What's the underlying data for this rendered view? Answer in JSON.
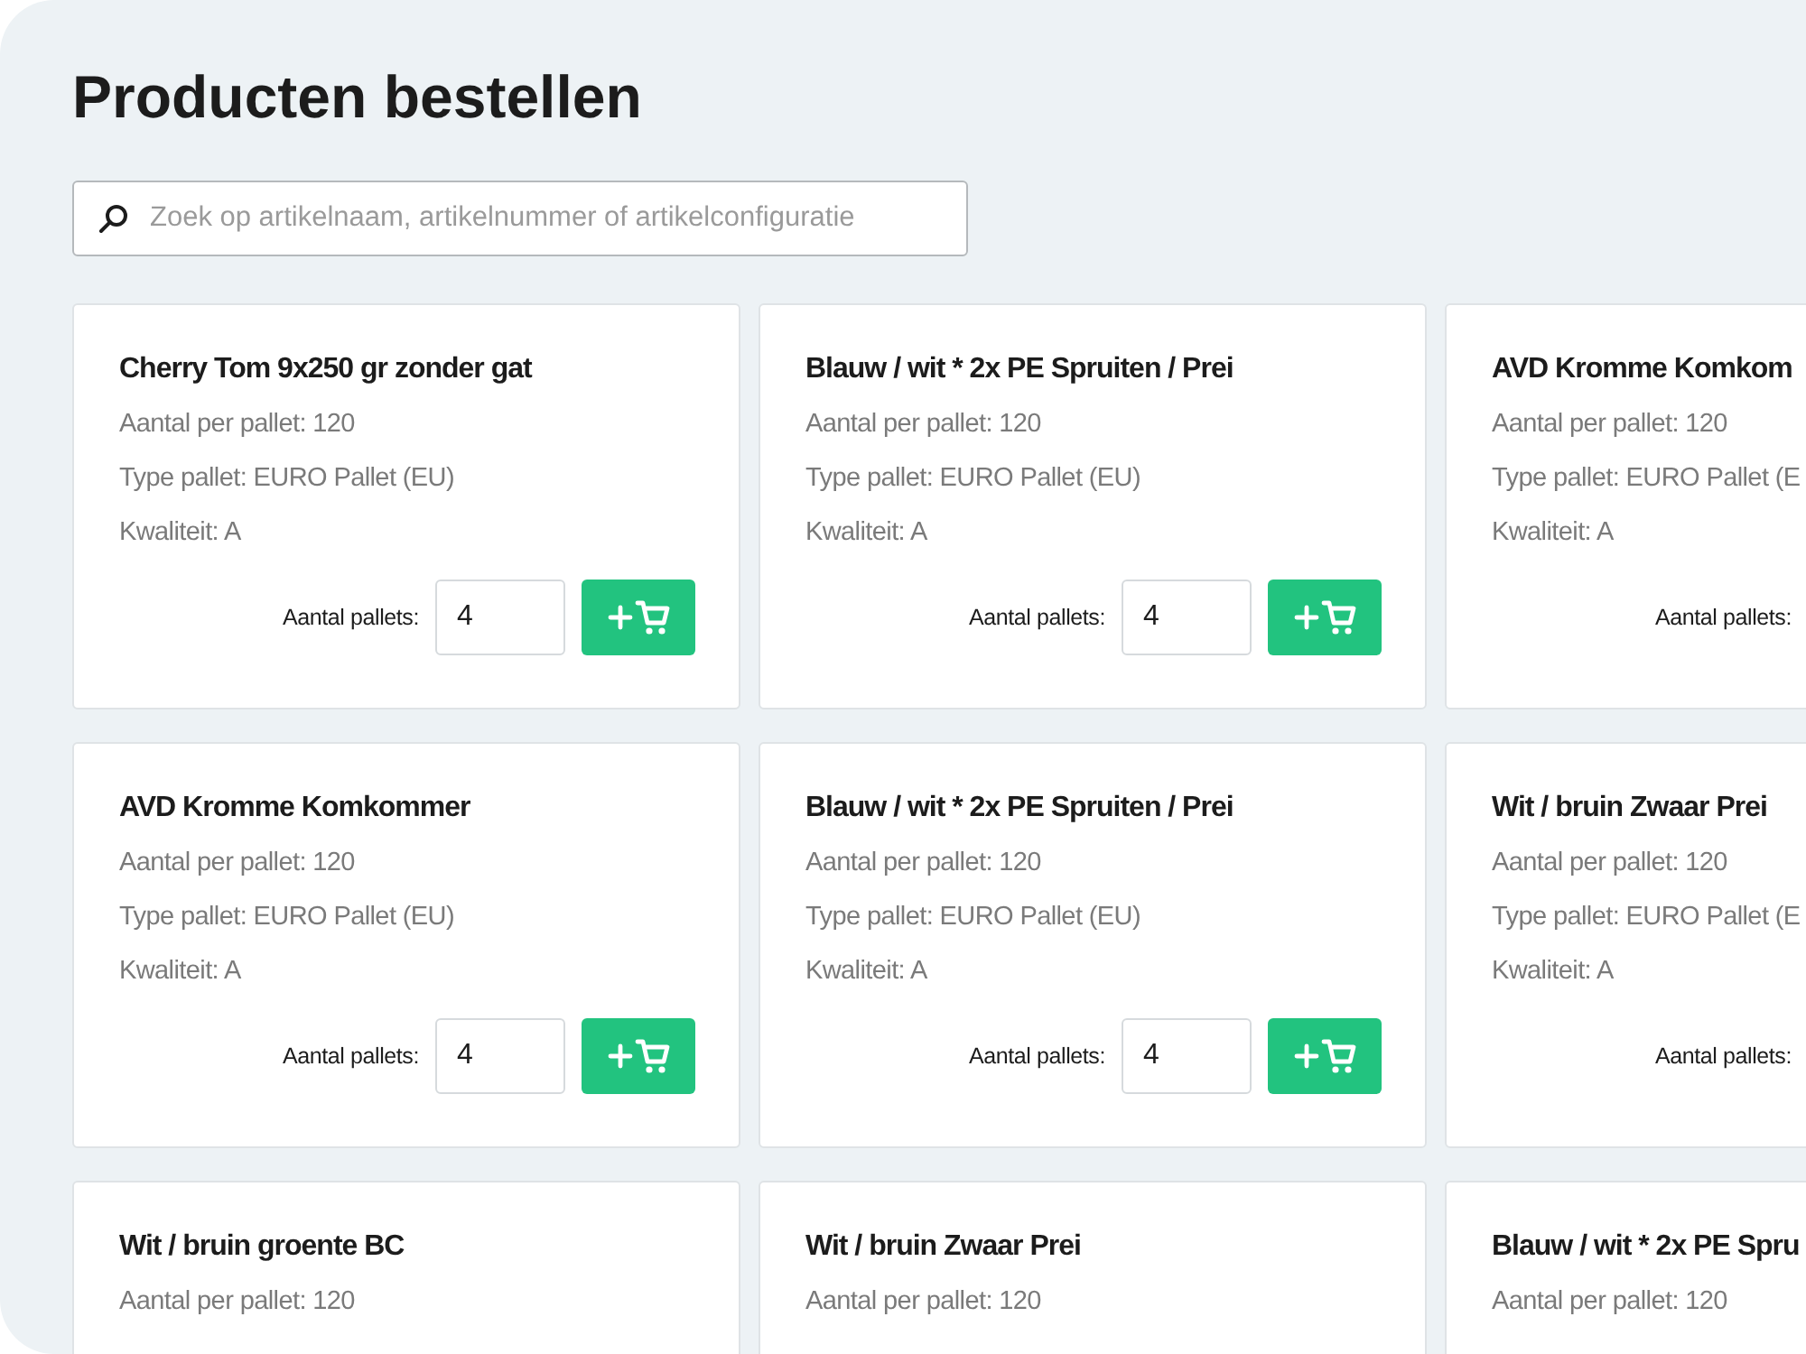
{
  "page_title": "Producten bestellen",
  "search": {
    "placeholder": "Zoek op artikelnaam, artikelnummer of artikelconfiguratie"
  },
  "products": [
    {
      "title": "Cherry Tom 9x250 gr zonder gat",
      "details": [
        "Aantal per pallet: 120",
        "Type pallet: EURO Pallet (EU)",
        "Kwaliteit: A"
      ],
      "quantity_label": "Aantal pallets:",
      "quantity": "4"
    },
    {
      "title": "Blauw / wit * 2x PE Spruiten / Prei",
      "details": [
        "Aantal per pallet: 120",
        "Type pallet: EURO Pallet (EU)",
        "Kwaliteit: A"
      ],
      "quantity_label": "Aantal pallets:",
      "quantity": "4"
    },
    {
      "title": "AVD Kromme Komkom",
      "details": [
        "Aantal per pallet: 120",
        "Type pallet: EURO Pallet (E",
        "Kwaliteit: A"
      ],
      "quantity_label": "Aantal pallets:"
    },
    {
      "title": "AVD Kromme Komkommer",
      "details": [
        "Aantal per pallet: 120",
        "Type pallet: EURO Pallet (EU)",
        "Kwaliteit: A"
      ],
      "quantity_label": "Aantal pallets:",
      "quantity": "4"
    },
    {
      "title": "Blauw / wit * 2x PE Spruiten / Prei",
      "details": [
        "Aantal per pallet: 120",
        "Type pallet: EURO Pallet (EU)",
        "Kwaliteit: A"
      ],
      "quantity_label": "Aantal pallets:",
      "quantity": "4"
    },
    {
      "title": "Wit / bruin Zwaar Prei",
      "details": [
        "Aantal per pallet: 120",
        "Type pallet: EURO Pallet (E",
        "Kwaliteit: A"
      ],
      "quantity_label": "Aantal pallets:"
    },
    {
      "title": "Wit / bruin groente BC",
      "details": [
        "Aantal per pallet: 120"
      ]
    },
    {
      "title": "Wit / bruin Zwaar Prei",
      "details": [
        "Aantal per pallet: 120"
      ]
    },
    {
      "title": "Blauw / wit * 2x PE Spru",
      "details": [
        "Aantal per pallet: 120"
      ]
    }
  ]
}
